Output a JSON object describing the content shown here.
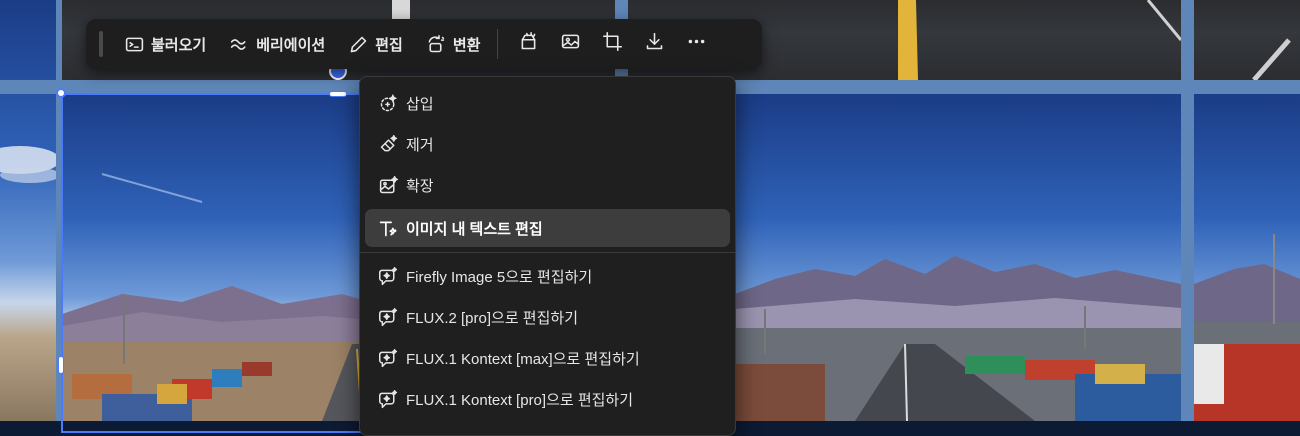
{
  "toolbar": {
    "buttons": [
      {
        "label": "불러오기",
        "icon": "terminal-prompt-icon"
      },
      {
        "label": "베리에이션",
        "icon": "approx-wave-icon"
      },
      {
        "label": "편집",
        "icon": "pencil-icon"
      },
      {
        "label": "변환",
        "icon": "transform-sparkle-icon"
      }
    ],
    "icon_buttons": [
      "magic-box-icon",
      "image-icon",
      "crop-icon",
      "download-icon",
      "more-icon"
    ]
  },
  "edit_menu": {
    "items": [
      {
        "label": "삽입",
        "icon": "generative-insert-icon",
        "active": false
      },
      {
        "label": "제거",
        "icon": "eraser-sparkle-icon",
        "active": false
      },
      {
        "label": "확장",
        "icon": "expand-image-icon",
        "active": false
      },
      {
        "label": "이미지 내 텍스트 편집",
        "icon": "text-edit-icon",
        "active": true
      }
    ],
    "model_items": [
      {
        "label": "Firefly Image 5으로 편집하기",
        "icon": "chat-sparkle-icon"
      },
      {
        "label": "FLUX.2 [pro]으로 편집하기",
        "icon": "chat-sparkle-icon"
      },
      {
        "label": "FLUX.1 Kontext [max]으로 편집하기",
        "icon": "chat-sparkle-icon"
      },
      {
        "label": "FLUX.1 Kontext [pro]으로 편집하기",
        "icon": "chat-sparkle-icon"
      }
    ]
  },
  "colors": {
    "toolbar_bg": "#1e1e1e",
    "menu_bg": "#1f1f1f",
    "menu_active": "#3d3d3d",
    "selection": "#4a7bff",
    "text": "#e8e8e8"
  }
}
